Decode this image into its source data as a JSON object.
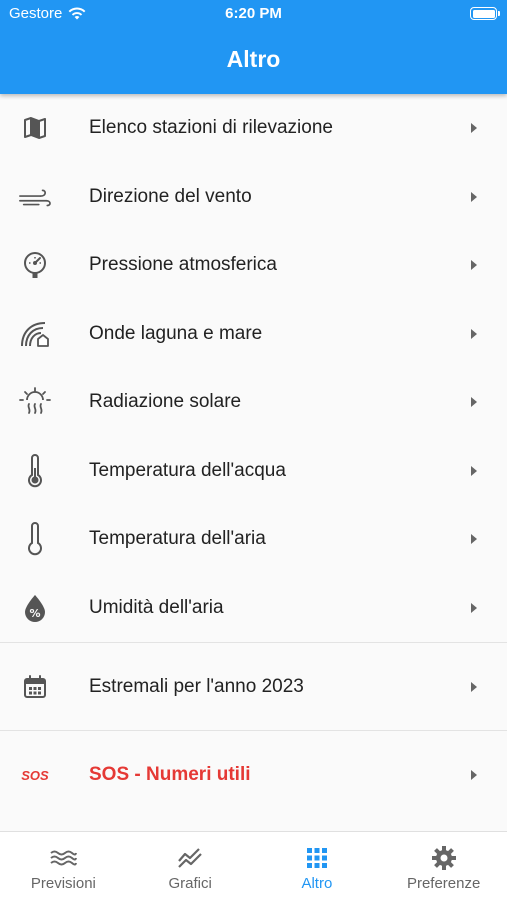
{
  "status_bar": {
    "carrier": "Gestore",
    "time": "6:20 PM"
  },
  "header": {
    "title": "Altro",
    "color": "#2196f3"
  },
  "menu": {
    "items": [
      {
        "label": "Elenco stazioni di rilevazione",
        "icon": "map-icon"
      },
      {
        "label": "Direzione del vento",
        "icon": "wind-icon"
      },
      {
        "label": "Pressione atmosferica",
        "icon": "gauge-icon"
      },
      {
        "label": "Onde laguna e mare",
        "icon": "waves-house-icon"
      },
      {
        "label": "Radiazione solare",
        "icon": "sun-heat-icon"
      },
      {
        "label": "Temperatura dell'acqua",
        "icon": "thermometer-filled-icon"
      },
      {
        "label": "Temperatura dell'aria",
        "icon": "thermometer-icon"
      },
      {
        "label": "Umidità dell'aria",
        "icon": "humidity-drop-icon"
      }
    ],
    "extremes": {
      "label": "Estremali per l'anno 2023",
      "icon": "calendar-icon"
    },
    "sos": {
      "label": "SOS - Numeri utili",
      "icon_text": "SOS",
      "color": "#e53935"
    }
  },
  "tabbar": {
    "tabs": [
      {
        "label": "Previsioni",
        "icon": "waves-icon"
      },
      {
        "label": "Grafici",
        "icon": "chart-line-icon"
      },
      {
        "label": "Altro",
        "icon": "grid-icon",
        "active": true
      },
      {
        "label": "Preferenze",
        "icon": "gear-icon"
      }
    ],
    "active_color": "#2196f3"
  }
}
